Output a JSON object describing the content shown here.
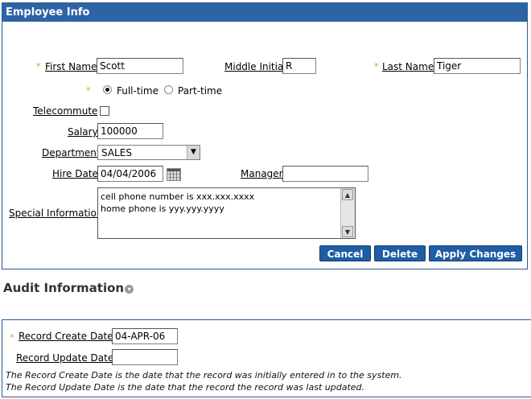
{
  "employee_info": {
    "title": "Employee Info",
    "first_name": {
      "label": "First Name",
      "value": "Scott"
    },
    "middle_initial": {
      "label": "Middle Initial",
      "value": "R"
    },
    "last_name": {
      "label": "Last Name",
      "value": "Tiger"
    },
    "employment_type": {
      "options": [
        "Full-time",
        "Part-time"
      ],
      "selected": "Full-time"
    },
    "telecommute": {
      "label": "Telecommute",
      "checked": false
    },
    "salary": {
      "label": "Salary",
      "value": "100000"
    },
    "department": {
      "label": "Department",
      "value": "SALES"
    },
    "hire_date": {
      "label": "Hire Date",
      "value": "04/04/2006"
    },
    "manager": {
      "label": "Manager",
      "value": ""
    },
    "special_information": {
      "label": "Special Information",
      "value": "cell phone number is xxx.xxx.xxxx\nhome phone is yyy.yyy.yyyy"
    },
    "buttons": {
      "cancel": "Cancel",
      "delete": "Delete",
      "apply": "Apply Changes"
    }
  },
  "audit_info": {
    "title": "Audit Information",
    "record_create_date": {
      "label": "Record Create Date:",
      "value": "04-APR-06"
    },
    "record_update_date": {
      "label": "Record Update Date:",
      "value": ""
    },
    "note1": "The Record Create Date is the date that the record was initially entered in to the system.",
    "note2": "The Record Update Date is the date that the record the record was last updated."
  },
  "colors": {
    "header": "#2e63a6",
    "button": "#1f5da4",
    "required": "#e39a10"
  },
  "required_mark": "*"
}
